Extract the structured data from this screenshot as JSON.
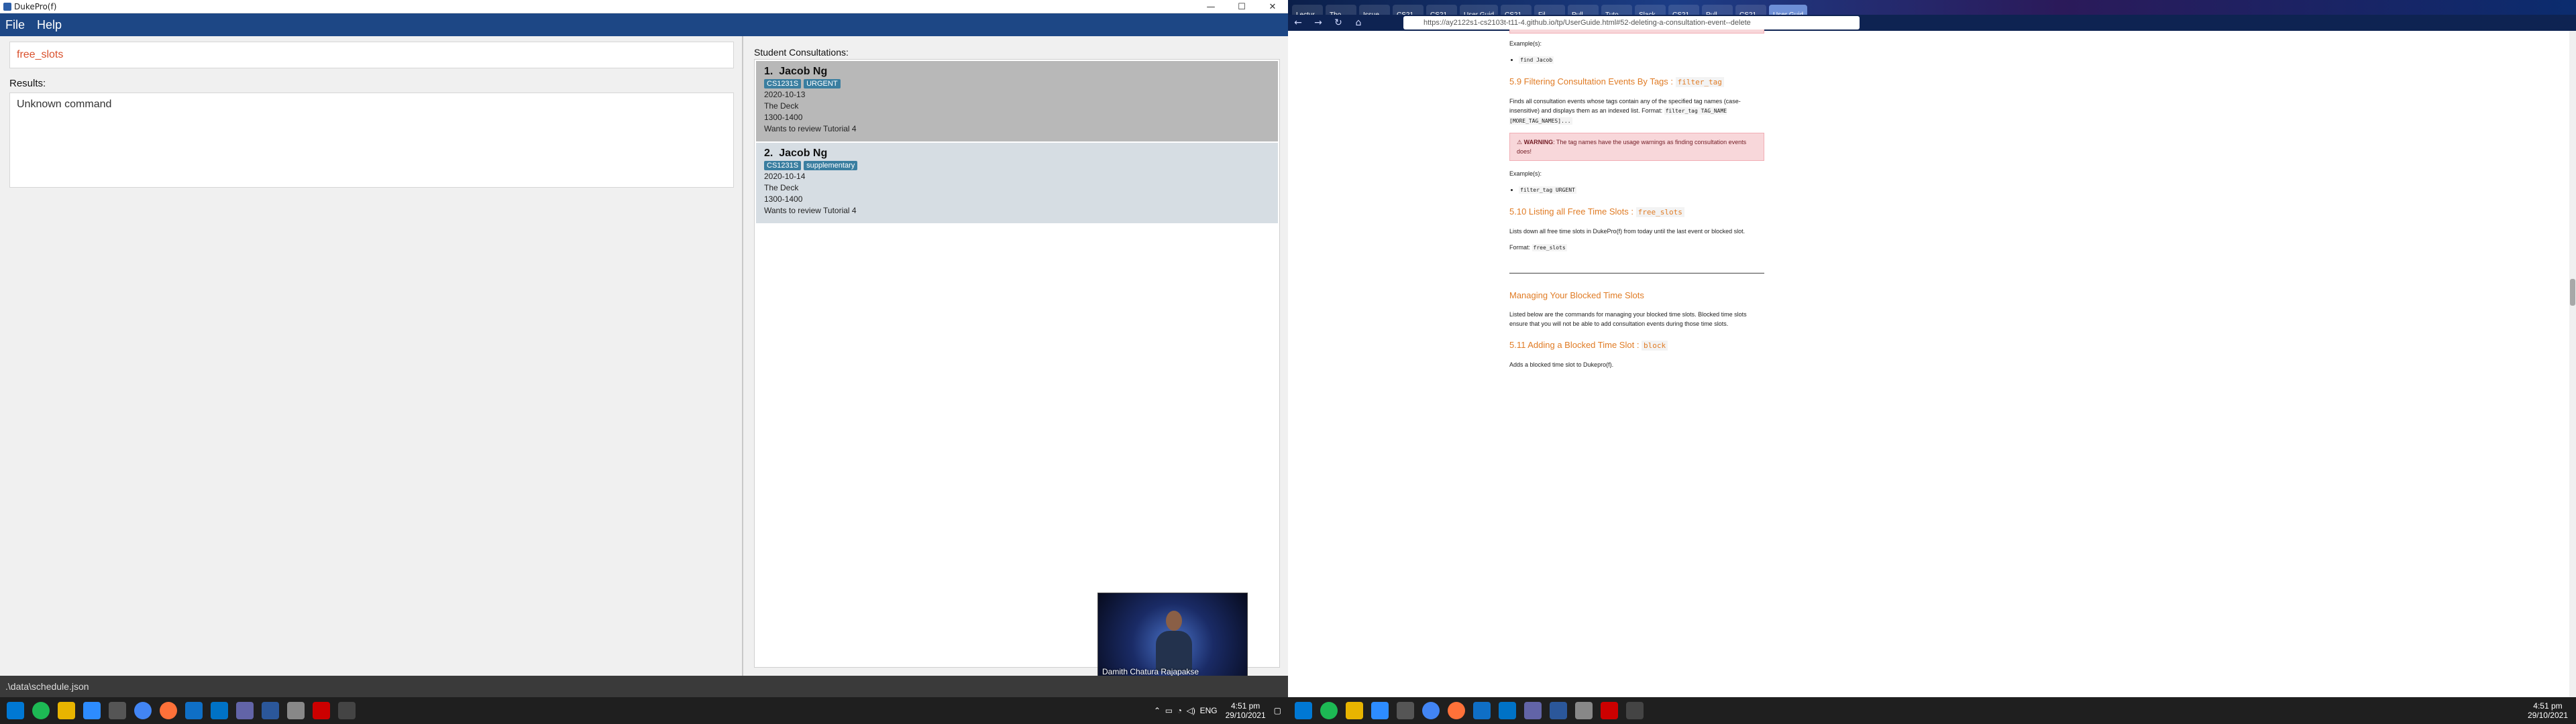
{
  "left_app": {
    "window_title": "DukePro(f)",
    "window_controls": [
      "—",
      "☐",
      "✕"
    ],
    "menu": [
      "File",
      "Help"
    ],
    "command_input_value": "free_slots",
    "results_label": "Results:",
    "result_text": "Unknown command",
    "consultations_label": "Student Consultations:",
    "consultations": [
      {
        "index": "1.",
        "name": "Jacob Ng",
        "tags": [
          "CS1231S",
          "URGENT"
        ],
        "date": "2020-10-13",
        "location": "The Deck",
        "time": "1300-1400",
        "description": "Wants to review Tutorial 4"
      },
      {
        "index": "2.",
        "name": "Jacob Ng",
        "tags": [
          "CS1231S",
          "supplementary"
        ],
        "date": "2020-10-14",
        "location": "The Deck",
        "time": "1300-1400",
        "description": "Wants to review Tutorial 4"
      }
    ],
    "status_path": ".\\data\\schedule.json",
    "video_caller_name": "Damith Chatura Rajapakse"
  },
  "taskbar": {
    "clock_time": "4:51 pm",
    "clock_date": "29/10/2021",
    "lang": "ENG",
    "right_clock_time": "4:51 pm",
    "right_clock_date": "29/10/2021"
  },
  "browser": {
    "tabs": [
      "Lectur",
      "Tho",
      "Issue",
      "CS21",
      "CS21",
      "User Guid",
      "CS21",
      "Fil",
      "Pull",
      "Tuto",
      "Slack",
      "CS21",
      "Pull",
      "CS21",
      "User Guid"
    ],
    "url": "https://ay2122s1-cs2103t-t11-4.github.io/tp/UserGuide.html#52-deleting-a-consultation-event--delete",
    "doc": {
      "examples_label_1": "Example(s):",
      "example_find": "find Jacob",
      "h_filter": "5.9 Filtering Consultation Events By Tags : ",
      "h_filter_code": "filter_tag",
      "filter_desc": "Finds all consultation events whose tags contain any of the specified tag names (case-insensitive) and displays them as an indexed list. Format: ",
      "filter_format": "filter_tag TAG_NAME [MORE_TAG_NAMES]...",
      "warning_label": "WARNING",
      "warning_text": ": The tag names have the usage warnings as finding consultation events does!",
      "examples_label_2": "Example(s):",
      "example_filter": "filter_tag URGENT",
      "h_free": "5.10 Listing all Free Time Slots : ",
      "h_free_code": "free_slots",
      "free_desc": "Lists down all free time slots in DukePro(f) from today until the last event or blocked slot.",
      "format_label": "Format: ",
      "free_format": "free_slots",
      "h_blocked": "Managing Your Blocked Time Slots",
      "blocked_desc": "Listed below are the commands for managing your blocked time slots. Blocked time slots ensure that you will not be able to add consultation events during those time slots.",
      "h_block": "5.11 Adding a Blocked Time Slot : ",
      "h_block_code": "block",
      "block_desc": "Adds a blocked time slot to Dukepro(f)."
    }
  }
}
